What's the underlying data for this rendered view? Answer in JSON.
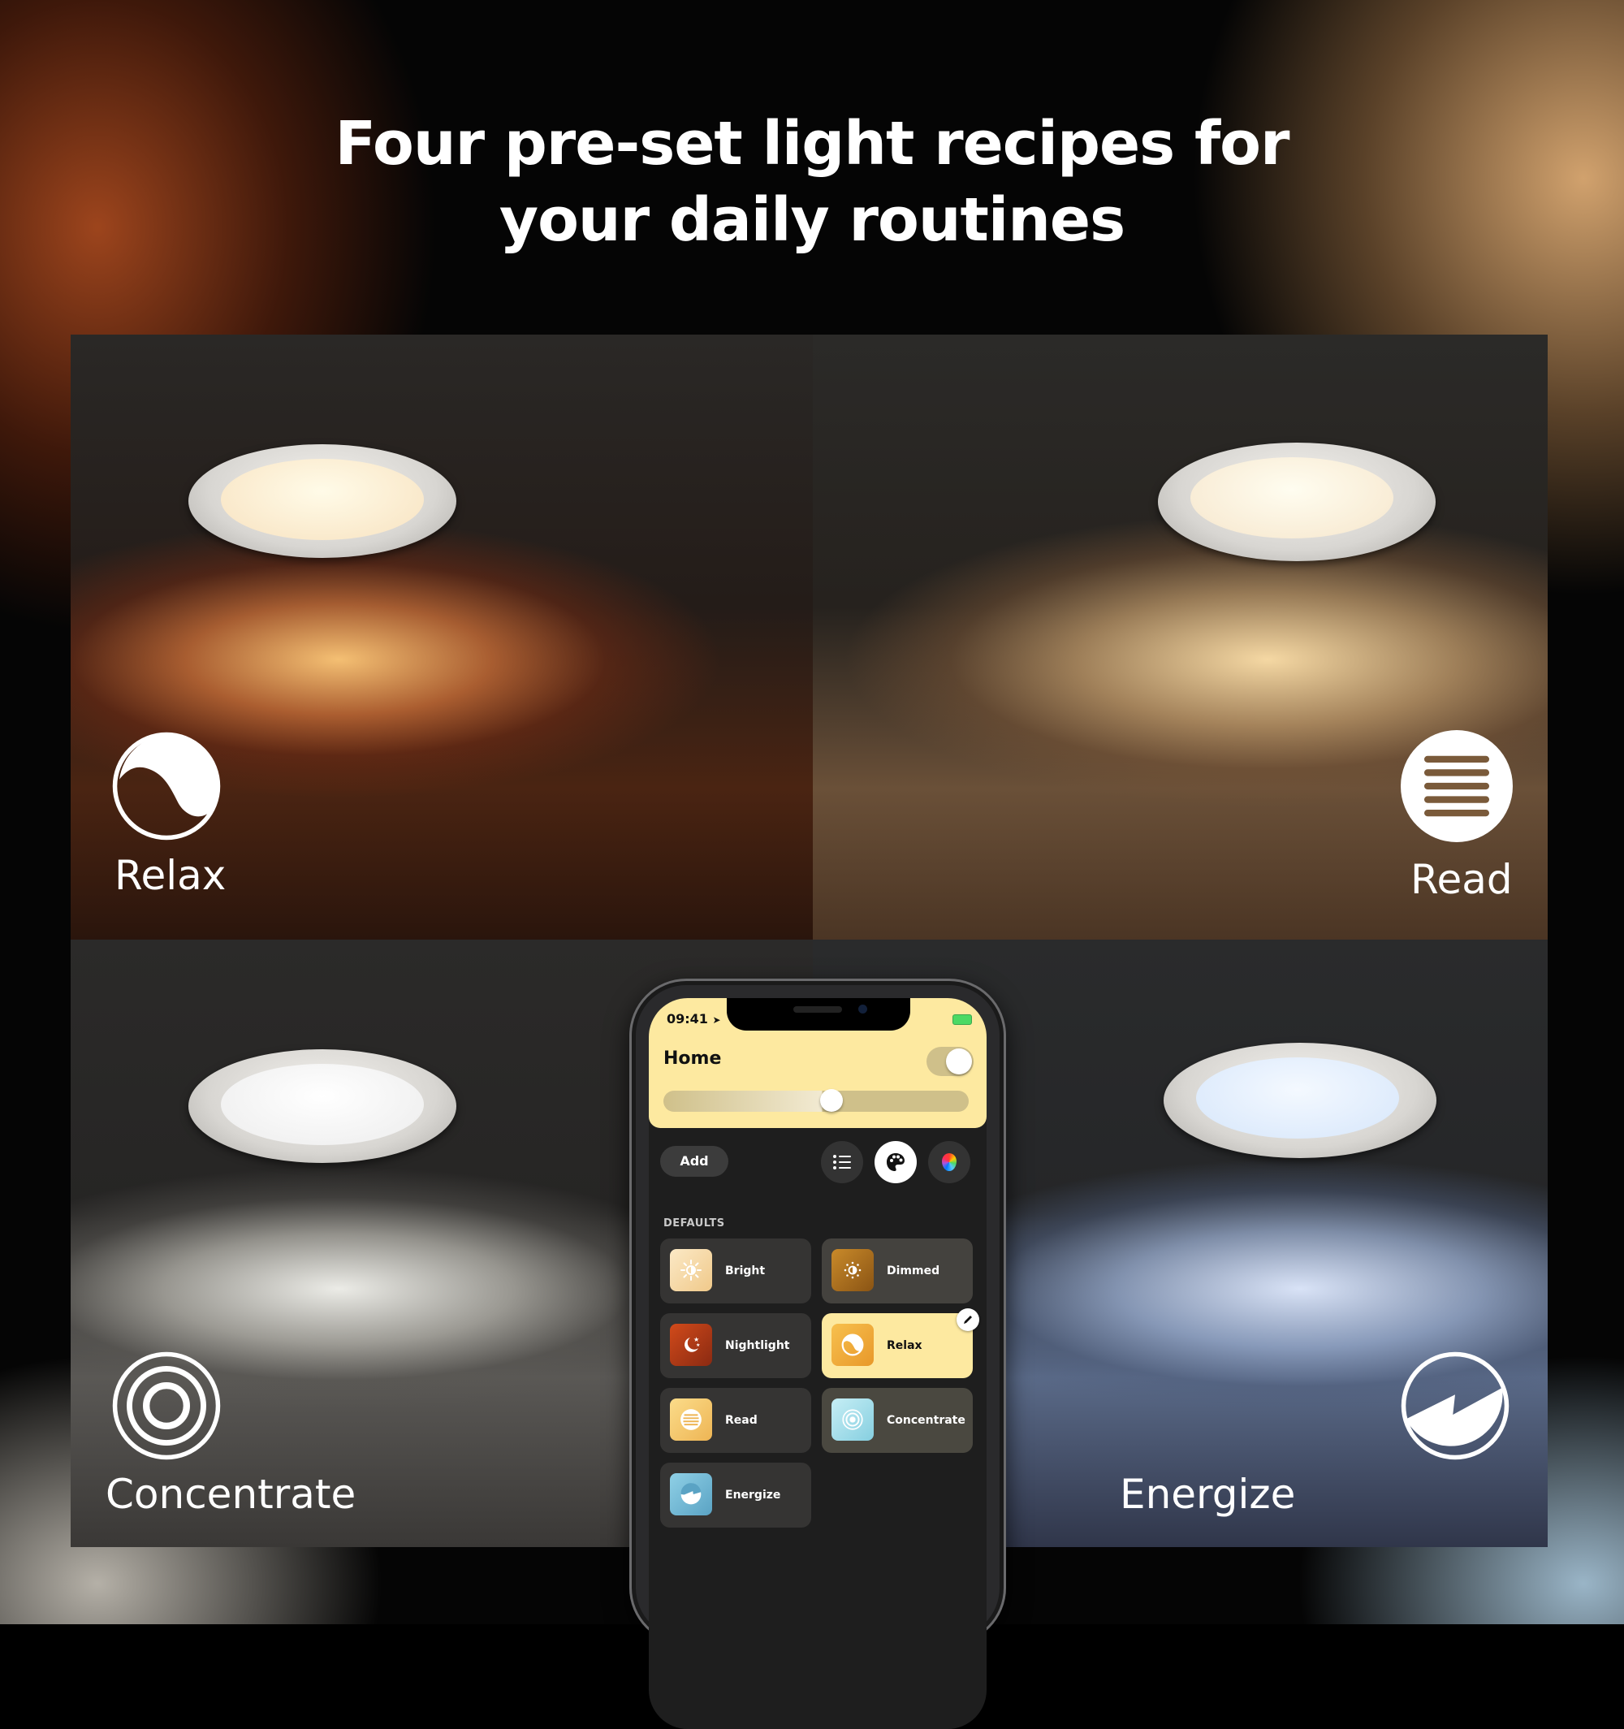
{
  "headline": {
    "line1": "Four pre-set light recipes for",
    "line2": "your daily routines"
  },
  "scenes": [
    {
      "name": "Relax",
      "icon": "relax-yin-yang-icon"
    },
    {
      "name": "Read",
      "icon": "read-lines-icon"
    },
    {
      "name": "Concentrate",
      "icon": "concentrate-rings-icon"
    },
    {
      "name": "Energize",
      "icon": "energize-bolt-icon"
    }
  ],
  "phone": {
    "status_time": "09:41",
    "status_icons": [
      "location-arrow-icon",
      "battery-charging-icon"
    ],
    "room_title": "Home",
    "power_on": true,
    "brightness_fraction": 0.55,
    "add_label": "Add",
    "view_buttons": [
      {
        "icon": "list-icon",
        "active": false
      },
      {
        "icon": "palette-icon",
        "active": true
      },
      {
        "icon": "color-picker-icon",
        "active": false
      }
    ],
    "section_label": "DEFAULTS",
    "scenes": [
      {
        "label": "Bright",
        "icon": "sun-icon",
        "color": "#f3d7a0",
        "selected": false
      },
      {
        "label": "Dimmed",
        "icon": "dim-sun-icon",
        "color": "#b7791f",
        "selected": false
      },
      {
        "label": "Nightlight",
        "icon": "moon-stars-icon",
        "color": "#b8401a",
        "selected": false
      },
      {
        "label": "Relax",
        "icon": "relax-icon",
        "color": "#f0ae3c",
        "selected": true
      },
      {
        "label": "Read",
        "icon": "read-icon",
        "color": "#f2c86a",
        "selected": false
      },
      {
        "label": "Concentrate",
        "icon": "concentrate-icon",
        "color": "#9fdbe8",
        "selected": false
      },
      {
        "label": "Energize",
        "icon": "energize-icon",
        "color": "#6fb5d0",
        "selected": false
      }
    ]
  },
  "colors": {
    "header_yellow": "#fde9a0",
    "tile_dark": "#353433",
    "relax_warm": "#e08a3c",
    "energize_cool": "#c9d8f5"
  }
}
